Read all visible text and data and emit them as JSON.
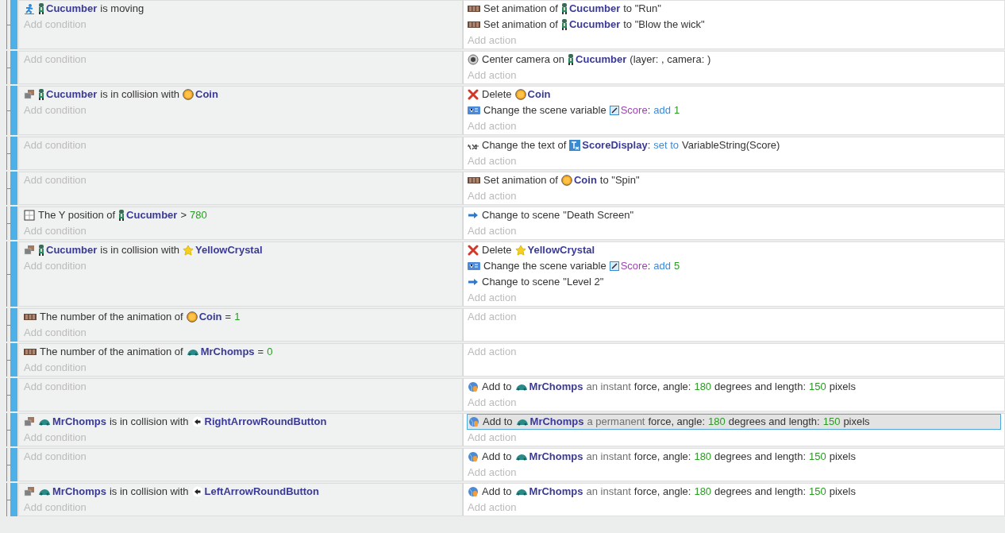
{
  "events": [
    {
      "conditions": [
        {
          "kind": "movement",
          "parts": [
            {
              "kind": "character",
              "text": "Cucumber"
            },
            {
              "kind": "text",
              "text": "is moving"
            }
          ]
        }
      ],
      "add_condition": "Add condition",
      "actions": [
        {
          "kind": "animation",
          "selected": false,
          "parts": [
            {
              "kind": "text",
              "text": "Set animation of"
            },
            {
              "kind": "character",
              "text": "Cucumber"
            },
            {
              "kind": "text",
              "text": "to \"Run\""
            }
          ]
        },
        {
          "kind": "animation",
          "selected": false,
          "parts": [
            {
              "kind": "text",
              "text": "Set animation of"
            },
            {
              "kind": "character",
              "text": "Cucumber"
            },
            {
              "kind": "text",
              "text": "to \"Blow the wick\""
            }
          ]
        }
      ],
      "add_action": "Add action"
    },
    {
      "add_condition": "Add condition",
      "actions": [
        {
          "kind": "camera",
          "selected": false,
          "parts": [
            {
              "kind": "text",
              "text": "Center camera on"
            },
            {
              "kind": "character",
              "text": "Cucumber"
            },
            {
              "kind": "text",
              "text": "(layer: , camera: )"
            }
          ]
        }
      ],
      "add_action": "Add action"
    },
    {
      "conditions": [
        {
          "kind": "collision",
          "parts": [
            {
              "kind": "character",
              "text": "Cucumber"
            },
            {
              "kind": "text",
              "text": "is in collision with"
            },
            {
              "kind": "coin",
              "text": "Coin"
            }
          ]
        }
      ],
      "add_condition": "Add condition",
      "actions": [
        {
          "kind": "delete",
          "selected": false,
          "parts": [
            {
              "kind": "text",
              "text": "Delete"
            },
            {
              "kind": "coin",
              "text": "Coin"
            }
          ]
        },
        {
          "kind": "variable",
          "selected": false,
          "parts": [
            {
              "kind": "text",
              "text": "Change the scene variable"
            },
            {
              "kind": "variable",
              "text": "Score"
            },
            {
              "kind": "punct",
              "text": ":"
            },
            {
              "kind": "op",
              "text": "add"
            },
            {
              "kind": "number",
              "text": "1"
            }
          ]
        }
      ],
      "add_action": "Add action"
    },
    {
      "add_condition": "Add condition",
      "actions": [
        {
          "kind": "text",
          "selected": false,
          "parts": [
            {
              "kind": "text",
              "text": "Change the text of"
            },
            {
              "kind": "textobject",
              "text": "ScoreDisplay"
            },
            {
              "kind": "punct",
              "text": ":"
            },
            {
              "kind": "op",
              "text": "set to"
            },
            {
              "kind": "text",
              "text": "VariableString(Score)"
            }
          ]
        }
      ],
      "add_action": "Add action"
    },
    {
      "add_condition": "Add condition",
      "actions": [
        {
          "kind": "animation",
          "selected": false,
          "parts": [
            {
              "kind": "text",
              "text": "Set animation of"
            },
            {
              "kind": "coin",
              "text": "Coin"
            },
            {
              "kind": "text",
              "text": "to \"Spin\""
            }
          ]
        }
      ],
      "add_action": "Add action"
    },
    {
      "conditions": [
        {
          "kind": "position",
          "parts": [
            {
              "kind": "text",
              "text": "The Y position of"
            },
            {
              "kind": "character",
              "text": "Cucumber"
            },
            {
              "kind": "text",
              "text": ">"
            },
            {
              "kind": "number",
              "text": "780"
            }
          ]
        }
      ],
      "add_condition": "Add condition",
      "actions": [
        {
          "kind": "scene",
          "selected": false,
          "parts": [
            {
              "kind": "text",
              "text": "Change to scene"
            },
            {
              "kind": "text",
              "text": "\"Death Screen\""
            }
          ]
        }
      ],
      "add_action": "Add action"
    },
    {
      "conditions": [
        {
          "kind": "collision",
          "parts": [
            {
              "kind": "character",
              "text": "Cucumber"
            },
            {
              "kind": "text",
              "text": "is in collision with"
            },
            {
              "kind": "crystal",
              "text": "YellowCrystal"
            }
          ]
        }
      ],
      "add_condition": "Add condition",
      "actions": [
        {
          "kind": "delete",
          "selected": false,
          "parts": [
            {
              "kind": "text",
              "text": "Delete"
            },
            {
              "kind": "crystal",
              "text": "YellowCrystal"
            }
          ]
        },
        {
          "kind": "variable",
          "selected": false,
          "parts": [
            {
              "kind": "text",
              "text": "Change the scene variable"
            },
            {
              "kind": "variable",
              "text": "Score"
            },
            {
              "kind": "punct",
              "text": ":"
            },
            {
              "kind": "op",
              "text": "add"
            },
            {
              "kind": "number",
              "text": "5"
            }
          ]
        },
        {
          "kind": "scene",
          "selected": false,
          "parts": [
            {
              "kind": "text",
              "text": "Change to scene"
            },
            {
              "kind": "text",
              "text": "\"Level 2\""
            }
          ]
        }
      ],
      "add_action": "Add action"
    },
    {
      "conditions": [
        {
          "kind": "animation",
          "parts": [
            {
              "kind": "text",
              "text": "The number of the animation of"
            },
            {
              "kind": "coin",
              "text": "Coin"
            },
            {
              "kind": "text",
              "text": "="
            },
            {
              "kind": "number",
              "text": "1"
            }
          ]
        }
      ],
      "add_condition": "Add condition",
      "add_action": "Add action"
    },
    {
      "conditions": [
        {
          "kind": "animation",
          "parts": [
            {
              "kind": "text",
              "text": "The number of the animation of"
            },
            {
              "kind": "creature",
              "text": "MrChomps"
            },
            {
              "kind": "text",
              "text": "="
            },
            {
              "kind": "number",
              "text": "0"
            }
          ]
        }
      ],
      "add_condition": "Add condition",
      "add_action": "Add action"
    },
    {
      "add_condition": "Add condition",
      "actions": [
        {
          "kind": "force",
          "selected": false,
          "parts": [
            {
              "kind": "text",
              "text": "Add to"
            },
            {
              "kind": "creature",
              "text": "MrChomps"
            },
            {
              "kind": "muted",
              "text": "an instant"
            },
            {
              "kind": "text",
              "text": "force, angle:"
            },
            {
              "kind": "number",
              "text": "180"
            },
            {
              "kind": "text",
              "text": "degrees and length:"
            },
            {
              "kind": "number",
              "text": "150"
            },
            {
              "kind": "text",
              "text": "pixels"
            }
          ]
        }
      ],
      "add_action": "Add action"
    },
    {
      "conditions": [
        {
          "kind": "collision",
          "parts": [
            {
              "kind": "creature",
              "text": "MrChomps"
            },
            {
              "kind": "text",
              "text": "is in collision with"
            },
            {
              "kind": "button",
              "text": "RightArrowRoundButton"
            }
          ]
        }
      ],
      "add_condition": "Add condition",
      "actions": [
        {
          "kind": "force",
          "selected": true,
          "parts": [
            {
              "kind": "text",
              "text": "Add to"
            },
            {
              "kind": "creature",
              "text": "MrChomps"
            },
            {
              "kind": "muted",
              "text": "a permanent"
            },
            {
              "kind": "text",
              "text": "force, angle:"
            },
            {
              "kind": "number",
              "text": "180"
            },
            {
              "kind": "text",
              "text": "degrees and length:"
            },
            {
              "kind": "number",
              "text": "150"
            },
            {
              "kind": "text",
              "text": "pixels"
            }
          ]
        }
      ],
      "add_action": "Add action"
    },
    {
      "add_condition": "Add condition",
      "actions": [
        {
          "kind": "force",
          "selected": false,
          "parts": [
            {
              "kind": "text",
              "text": "Add to"
            },
            {
              "kind": "creature",
              "text": "MrChomps"
            },
            {
              "kind": "muted",
              "text": "an instant"
            },
            {
              "kind": "text",
              "text": "force, angle:"
            },
            {
              "kind": "number",
              "text": "180"
            },
            {
              "kind": "text",
              "text": "degrees and length:"
            },
            {
              "kind": "number",
              "text": "150"
            },
            {
              "kind": "text",
              "text": "pixels"
            }
          ]
        }
      ],
      "add_action": "Add action"
    },
    {
      "conditions": [
        {
          "kind": "collision",
          "parts": [
            {
              "kind": "creature",
              "text": "MrChomps"
            },
            {
              "kind": "text",
              "text": "is in collision with"
            },
            {
              "kind": "button",
              "text": "LeftArrowRoundButton"
            }
          ]
        }
      ],
      "add_condition": "Add condition",
      "actions": [
        {
          "kind": "force",
          "selected": false,
          "parts": [
            {
              "kind": "text",
              "text": "Add to"
            },
            {
              "kind": "creature",
              "text": "MrChomps"
            },
            {
              "kind": "muted",
              "text": "an instant"
            },
            {
              "kind": "text",
              "text": "force, angle:"
            },
            {
              "kind": "number",
              "text": "180"
            },
            {
              "kind": "text",
              "text": "degrees and length:"
            },
            {
              "kind": "number",
              "text": "150"
            },
            {
              "kind": "text",
              "text": "pixels"
            }
          ]
        }
      ],
      "add_action": "Add action"
    }
  ]
}
